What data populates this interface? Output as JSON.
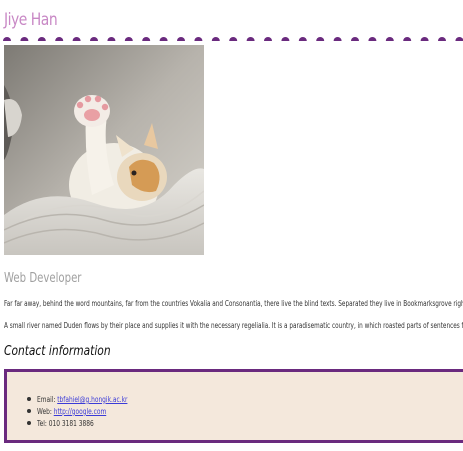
{
  "profile": {
    "name": "Jiye Han",
    "photo_alt": "kitten",
    "role": "Web Developer"
  },
  "paragraphs": {
    "p1": "Far far away, behind the word mountains, far from the countries Vokalia and Consonantia, there live the blind texts. Separated they live in Bookmarksgrove right a",
    "p2": "A small river named Duden flows by their place and supplies it with the necessary regelialia. It is a paradisematic country, in which roasted parts of sentences fly i"
  },
  "contact": {
    "heading": "Contact information",
    "email_label": "Email: ",
    "email_value": "tbfahiel@g.hongik.ac.kr",
    "web_label": "Web: ",
    "web_value": "http://google.com",
    "tel_label": "Tel: ",
    "tel_value": "010 3181 3886"
  },
  "colors": {
    "name": "#c888c5",
    "dots": "#6a2a7e",
    "box_border": "#6a2a7e",
    "box_background": "#f4e8dc",
    "link": "#3b3bd8"
  }
}
